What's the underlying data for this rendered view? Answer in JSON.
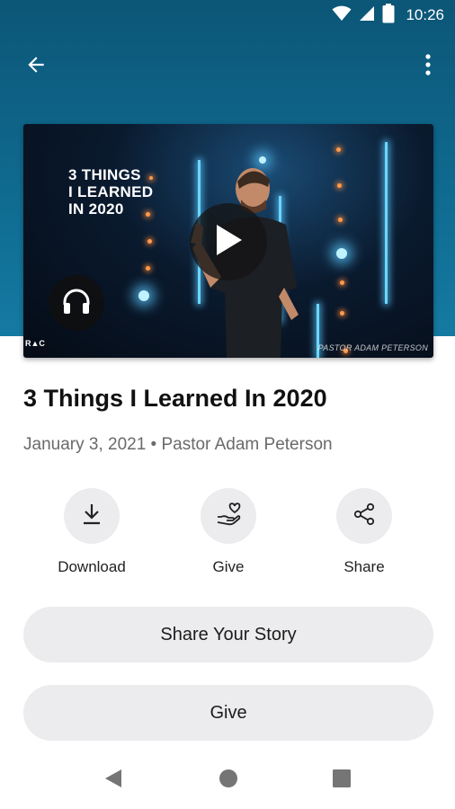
{
  "status_bar": {
    "time": "10:26",
    "icons": [
      "wifi-icon",
      "signal-icon",
      "battery-icon"
    ]
  },
  "app_bar": {
    "back_icon": "arrow-left-icon",
    "menu_icon": "more-vert-icon"
  },
  "video": {
    "title": "3 THINGS\nI LEARNED\nIN 2020",
    "caption": "PASTOR ADAM PETERSON",
    "logo_text": "R▲C",
    "play_icon": "play-icon",
    "audio_icon": "headphones-icon"
  },
  "sermon": {
    "title": "3 Things I Learned In 2020",
    "meta": "January 3, 2021 • Pastor Adam Peterson"
  },
  "actions": [
    {
      "label": "Download",
      "icon": "download-icon"
    },
    {
      "label": "Give",
      "icon": "give-hand-heart-icon"
    },
    {
      "label": "Share",
      "icon": "share-icon"
    }
  ],
  "buttons": {
    "share_story": "Share Your Story",
    "give": "Give"
  },
  "colors": {
    "header_blue": "#0f6a8f",
    "pill_gray": "#ececee",
    "meta_gray": "#6a6a6a"
  }
}
